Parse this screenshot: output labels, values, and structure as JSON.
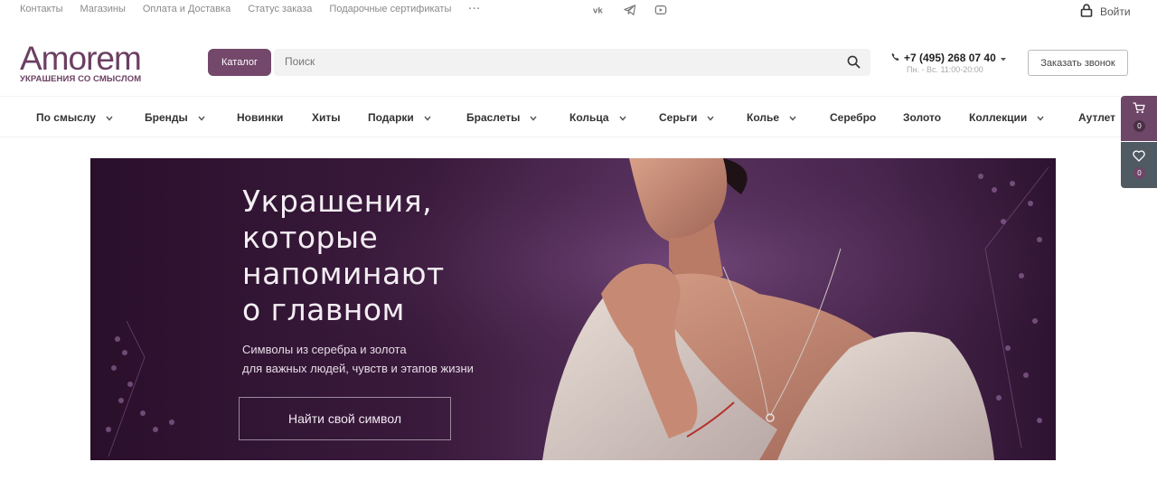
{
  "topbar": {
    "links": [
      "Контакты",
      "Магазины",
      "Оплата и Доставка",
      "Статус заказа",
      "Подарочные сертификаты"
    ],
    "more": "···",
    "social_icons": [
      "vk-icon",
      "telegram-icon",
      "youtube-icon"
    ],
    "login_label": "Войти"
  },
  "header": {
    "logo_word": "Amorem",
    "logo_tagline": "УКРАШЕНИЯ СО СМЫСЛОМ",
    "catalog_label": "Каталог",
    "search_placeholder": "Поиск",
    "phone": "+7 (495) 268 07 40",
    "hours": "Пн. - Вс. 11:00-20:00",
    "callback_label": "Заказать звонок"
  },
  "nav": {
    "items": [
      {
        "label": "По смыслу"
      },
      {
        "label": "Бренды"
      },
      {
        "label": "Новинки"
      },
      {
        "label": "Хиты"
      },
      {
        "label": "Подарки"
      },
      {
        "label": "Браслеты"
      },
      {
        "label": "Кольца"
      },
      {
        "label": "Серьги"
      },
      {
        "label": "Колье"
      },
      {
        "label": "Серебро"
      },
      {
        "label": "Золото"
      },
      {
        "label": "Коллекции"
      },
      {
        "label": "Аутлет"
      }
    ]
  },
  "side": {
    "cart_count": "0",
    "fav_count": "0"
  },
  "banner": {
    "title_lines": [
      "Украшения,",
      "которые",
      "напоминают",
      "о главном"
    ],
    "subtitle_lines": [
      "Символы из серебра и золота",
      "для важных людей, чувств и этапов жизни"
    ],
    "button_label": "Найти свой символ"
  },
  "colors": {
    "brand": "#73486b",
    "cart_panel": "#6e4667",
    "fav_panel": "#4f5a63"
  }
}
